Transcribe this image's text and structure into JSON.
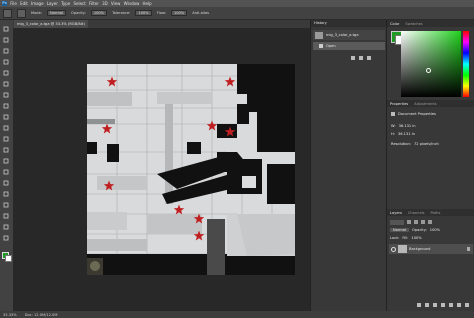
{
  "menu": {
    "items": [
      "File",
      "Edit",
      "Image",
      "Layer",
      "Type",
      "Select",
      "Filter",
      "3D",
      "View",
      "Window",
      "Help"
    ]
  },
  "options": {
    "mode_label": "Mode:",
    "mode_value": "Normal",
    "opacity_label": "Opacity:",
    "opacity_value": "100%",
    "flow_label": "Flow:",
    "flow_value": "100%",
    "tolerance_label": "Tolerance:",
    "tolerance_value": "100%",
    "antialias_label": "Anti-alias"
  },
  "document": {
    "tab_title": "mig_3_color_a.tga @ 33.3% (RGB/8#)"
  },
  "status": {
    "zoom": "33.33%",
    "doc_info": "Doc: 12.0M/12.0M"
  },
  "history": {
    "title": "History",
    "items": [
      {
        "label": "mig_3_color_a.tga"
      },
      {
        "label": "Open"
      }
    ]
  },
  "color": {
    "tabs": [
      "Color",
      "Swatches"
    ]
  },
  "properties": {
    "tabs": [
      "Properties",
      "Adjustments"
    ],
    "section_title": "Document Properties",
    "w_label": "W:",
    "w_value": "36.131 in",
    "h_label": "H:",
    "h_value": "36.131 in",
    "resolution_label": "Resolution:",
    "resolution_value": "72 pixels/inch"
  },
  "layers": {
    "tabs": [
      "Layers",
      "Channels",
      "Paths"
    ],
    "blend_mode": "Normal",
    "opacity_label": "Opacity:",
    "opacity_value": "100%",
    "lock_label": "Lock:",
    "fill_label": "Fill:",
    "fill_value": "100%",
    "items": [
      {
        "label": "Background"
      }
    ]
  },
  "texture": {
    "star_color": "#c01f22",
    "canvas_color": "#d9dadb"
  },
  "icons": [
    "move-icon",
    "marquee-icon",
    "lasso-icon",
    "quick-select-icon",
    "crop-icon",
    "eyedropper-icon",
    "healing-icon",
    "brush-icon",
    "stamp-icon",
    "history-brush-icon",
    "eraser-icon",
    "gradient-icon",
    "blur-icon",
    "dodge-icon",
    "pen-icon",
    "type-icon",
    "path-select-icon",
    "shape-icon",
    "hand-icon",
    "zoom-icon"
  ]
}
